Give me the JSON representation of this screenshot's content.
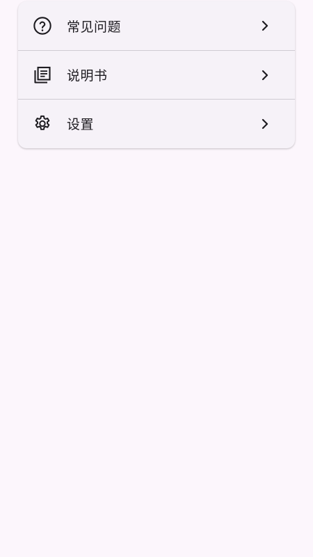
{
  "menu": {
    "items": [
      {
        "label": "常见问题",
        "icon": "help-circle-icon"
      },
      {
        "label": "说明书",
        "icon": "document-list-icon"
      },
      {
        "label": "设置",
        "icon": "gear-icon"
      }
    ]
  },
  "colors": {
    "background": "#fcf6fc",
    "card": "#f6f2f8",
    "text": "#1d1b20",
    "divider": "#cfcbd2"
  }
}
